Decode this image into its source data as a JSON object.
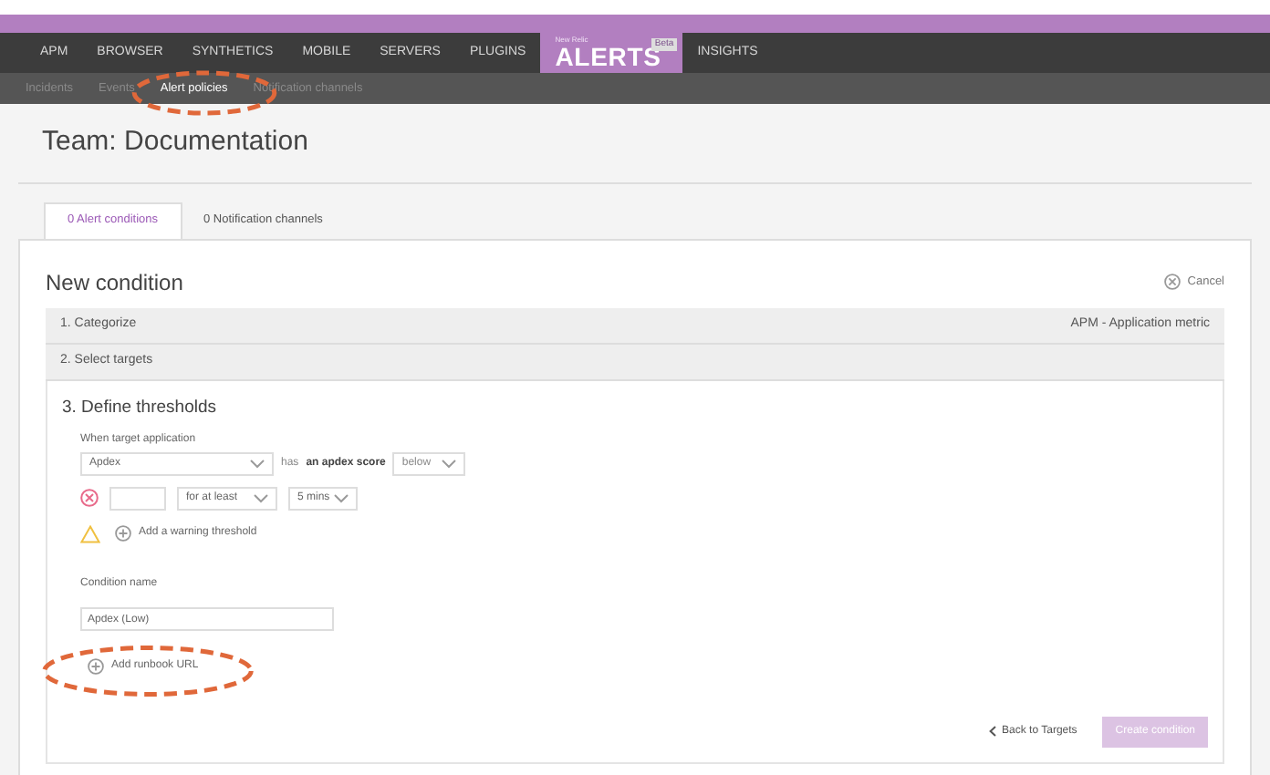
{
  "top_nav": {
    "items": [
      {
        "label": "APM",
        "kind": "link",
        "selected": false
      },
      {
        "label": "BROWSER",
        "kind": "link",
        "selected": false
      },
      {
        "label": "SYNTHETICS",
        "kind": "link",
        "selected": false
      },
      {
        "label": "MOBILE",
        "kind": "link",
        "selected": false
      },
      {
        "label": "SERVERS",
        "kind": "link",
        "selected": false
      },
      {
        "label": "PLUGINS",
        "kind": "link",
        "selected": false
      },
      {
        "label": "ALERTS",
        "kind": "logo",
        "small": "New Relic",
        "badge": "Beta",
        "selected": true
      },
      {
        "label": "INSIGHTS",
        "kind": "link",
        "selected": false
      }
    ]
  },
  "sub_nav": {
    "items": [
      {
        "label": "Incidents",
        "selected": false
      },
      {
        "label": "Events",
        "selected": false
      },
      {
        "label": "Alert policies",
        "selected": true
      },
      {
        "label": "Notification channels",
        "selected": false
      }
    ]
  },
  "page_title": "Team: Documentation",
  "tabs": [
    {
      "label": "0 Alert conditions",
      "selected": true
    },
    {
      "label": "0 Notification channels",
      "selected": false
    }
  ],
  "condition": {
    "title": "New condition",
    "cancel": "Cancel",
    "steps": [
      {
        "label": "1. Categorize",
        "value": "APM - Application metric"
      },
      {
        "label": "2. Select targets"
      }
    ],
    "thresholds": {
      "title": "3. Define thresholds",
      "target_label": "When target application",
      "metric": "Apdex",
      "has": "has",
      "score_label": "an apdex score",
      "comparison": "below",
      "critical": {
        "duration_mode": "for at least",
        "duration": "5 mins"
      },
      "warning_link": "Add a warning threshold"
    },
    "name_label": "Condition name",
    "name_value": "Apdex (Low)",
    "runbook_link": "Add runbook URL",
    "back": "Back to Targets",
    "create": {
      "label": "Create condition",
      "disabled": true
    }
  }
}
